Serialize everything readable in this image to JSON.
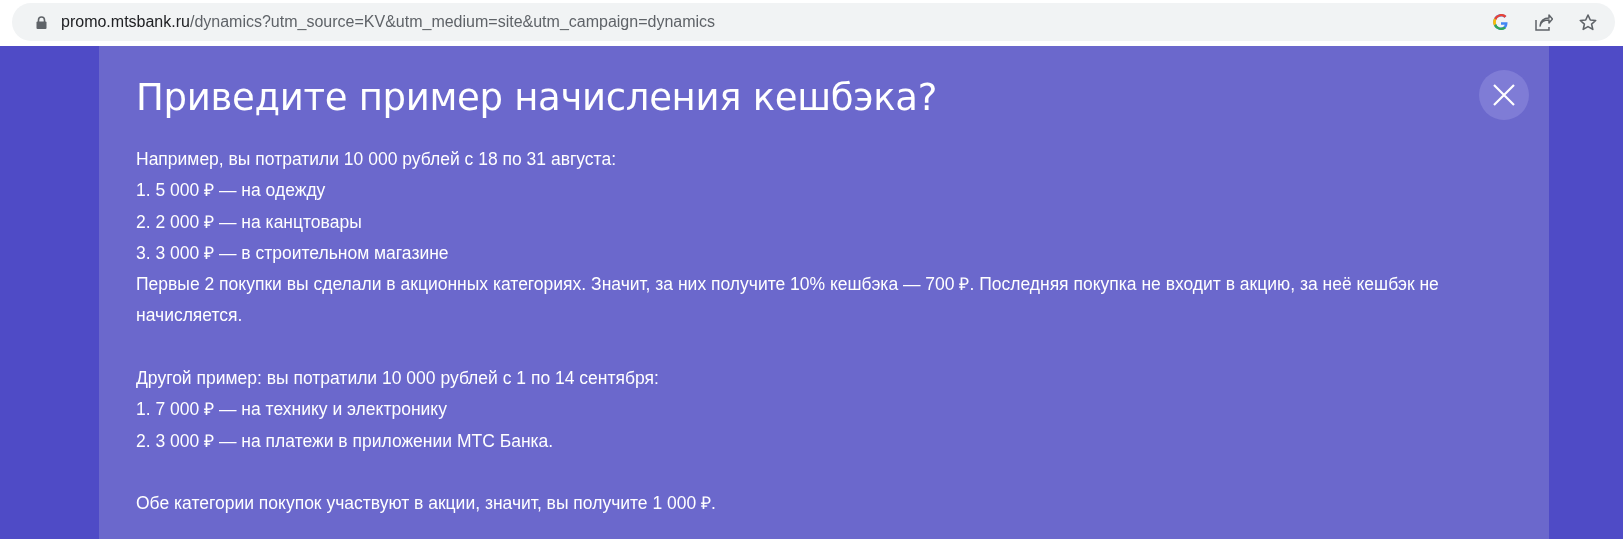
{
  "address_bar": {
    "host": "promo.mtsbank.ru",
    "path": "/dynamics?utm_source=KV&utm_medium=site&utm_campaign=dynamics"
  },
  "dialog": {
    "title": "Приведите пример начисления кешбэка?",
    "paragraphs": [
      [
        "Например, вы потратили 10 000 рублей с 18 по 31 августа:",
        "1. 5 000 ₽ — на одежду",
        "2. 2 000 ₽ — на канцтовары",
        "3. 3 000 ₽ — в строительном магазине",
        "Первые 2 покупки вы сделали в акционных категориях. Значит, за них получите 10% кешбэка — 700 ₽. Последняя покупка не входит в акцию, за неё кешбэк не начисляется."
      ],
      [
        "Другой пример: вы потратили 10 000 рублей с 1 по 14 сентября:",
        "1. 7 000 ₽ — на технику и электронику",
        "2. 3 000 ₽ — на платежи в приложении МТС Банка."
      ],
      [
        "Обе категории покупок участвуют в акции, значит, вы получите 1 000 ₽."
      ]
    ]
  }
}
